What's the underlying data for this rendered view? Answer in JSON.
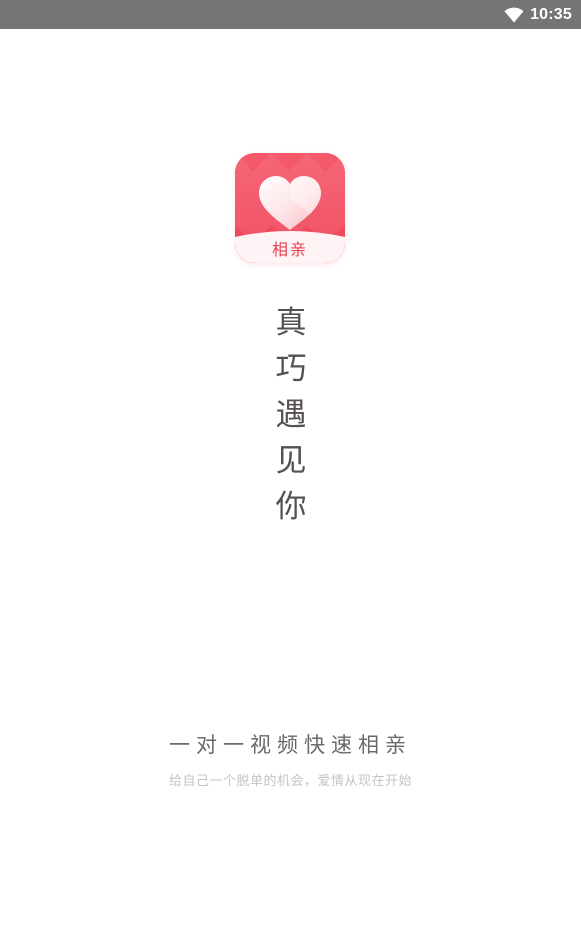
{
  "status_bar": {
    "time": "10:35",
    "wifi_icon": "wifi-icon"
  },
  "app_icon": {
    "label": "相亲",
    "icon": "heart-icon",
    "colors": {
      "background": "#f25163",
      "label": "#e3404f"
    }
  },
  "slogan": {
    "chars": [
      "真",
      "巧",
      "遇",
      "见",
      "你"
    ]
  },
  "tagline": "一对一视频快速相亲",
  "subtitle": "给自己一个脱单的机会，爱情从现在开始"
}
